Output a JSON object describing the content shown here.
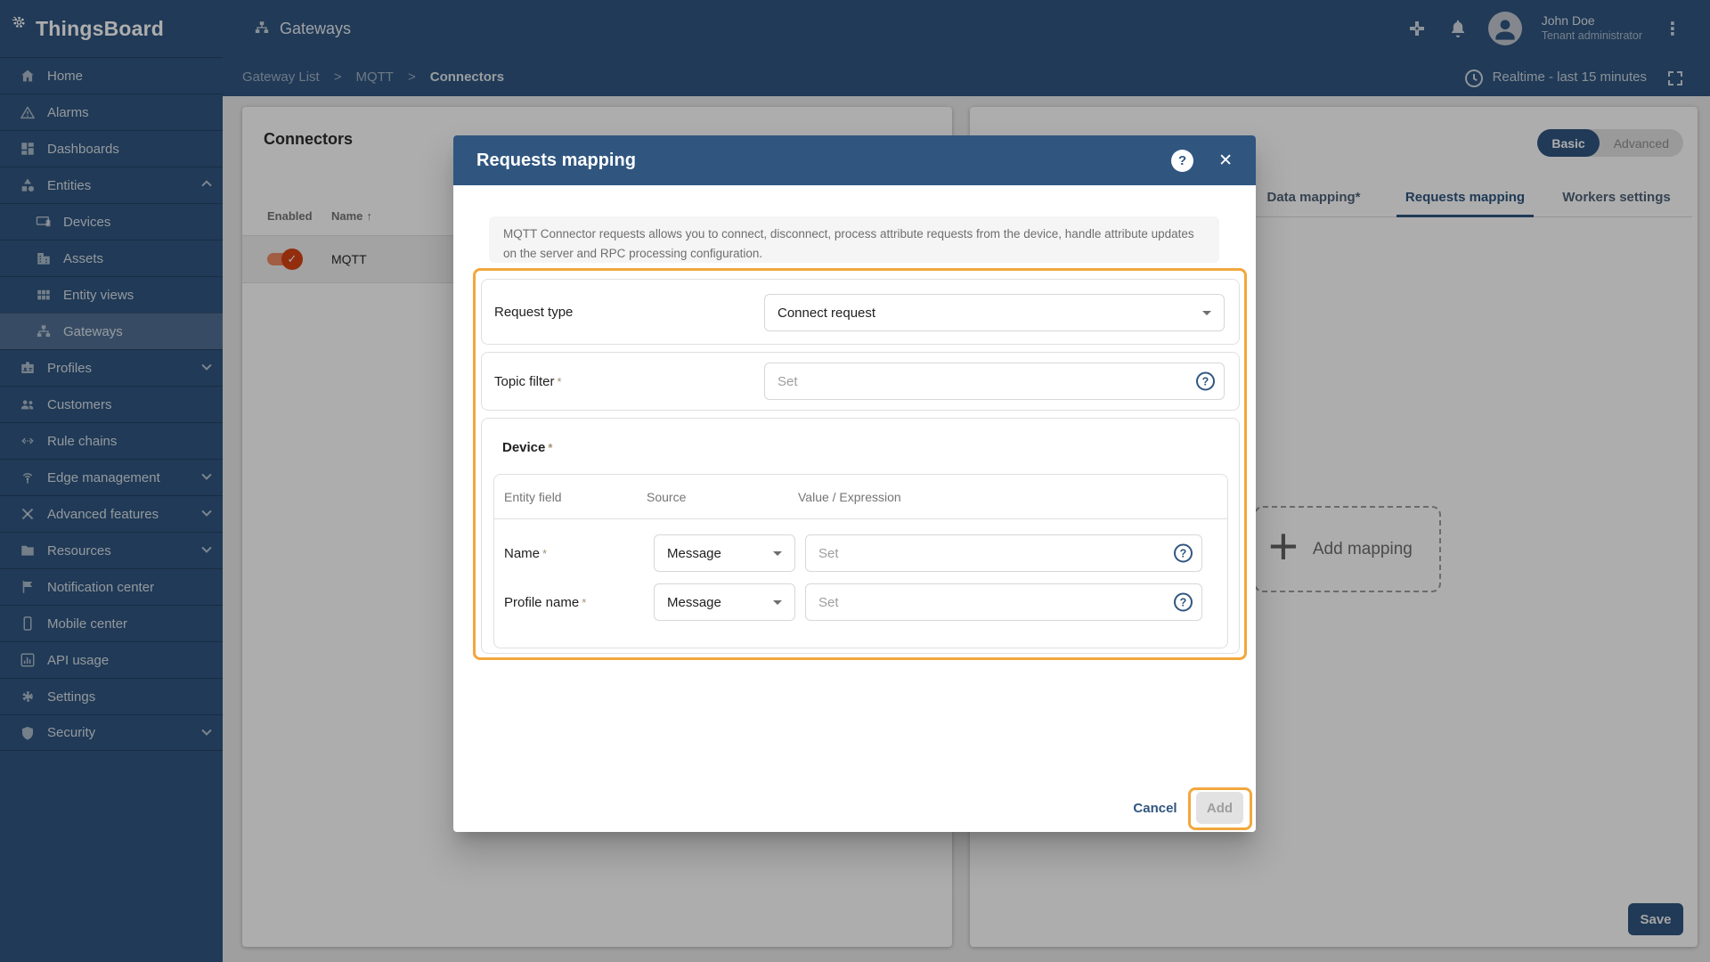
{
  "colors": {
    "primary": "#305680",
    "tutorial_highlight": "#f2a73d",
    "toggle_on": "#d84315"
  },
  "icons": {
    "sort_asc": "↑",
    "kebab": "⋮",
    "plus": "+",
    "close": "✕",
    "help": "?",
    "check": "✓"
  },
  "brand": {
    "name": "ThingsBoard"
  },
  "topbar": {
    "page_title": "Gateways",
    "user": {
      "name": "John Doe",
      "role": "Tenant administrator"
    }
  },
  "breadcrumb": {
    "separator": ">",
    "items": [
      "Gateway List",
      "MQTT",
      "Connectors"
    ]
  },
  "toolbar": {
    "realtime_label": "Realtime - last 15 minutes"
  },
  "sidebar": {
    "items": [
      {
        "label": "Home"
      },
      {
        "label": "Alarms"
      },
      {
        "label": "Dashboards"
      },
      {
        "label": "Entities"
      },
      {
        "label": "Devices"
      },
      {
        "label": "Assets"
      },
      {
        "label": "Entity views"
      },
      {
        "label": "Gateways"
      },
      {
        "label": "Profiles"
      },
      {
        "label": "Customers"
      },
      {
        "label": "Rule chains"
      },
      {
        "label": "Edge management"
      },
      {
        "label": "Advanced features"
      },
      {
        "label": "Resources"
      },
      {
        "label": "Notification center"
      },
      {
        "label": "Mobile center"
      },
      {
        "label": "API usage"
      },
      {
        "label": "Settings"
      },
      {
        "label": "Security"
      }
    ]
  },
  "connectors_panel": {
    "title": "Connectors",
    "columns": {
      "enabled": "Enabled",
      "name": "Name"
    },
    "rows": [
      {
        "name": "MQTT",
        "enabled": true
      }
    ]
  },
  "gateway_panel": {
    "mode": {
      "basic": "Basic",
      "advanced": "Advanced",
      "selected": "Basic"
    },
    "tabs": [
      {
        "label": "Data mapping*"
      },
      {
        "label": "Requests mapping"
      },
      {
        "label": "Workers settings"
      }
    ],
    "active_tab": "Requests mapping",
    "add_mapping_label": "Add mapping",
    "save_label": "Save"
  },
  "modal": {
    "title": "Requests mapping",
    "description": "MQTT Connector requests allows you to connect, disconnect, process attribute requests from the device, handle attribute updates on the server and RPC processing configuration.",
    "required_marker": "*",
    "request_type": {
      "label": "Request type",
      "value": "Connect request"
    },
    "topic_filter": {
      "label": "Topic filter",
      "placeholder": "Set"
    },
    "device": {
      "label": "Device",
      "columns": [
        "Entity field",
        "Source",
        "Value / Expression"
      ],
      "rows": [
        {
          "field": "Name",
          "source": "Message",
          "value_placeholder": "Set"
        },
        {
          "field": "Profile name",
          "source": "Message",
          "value_placeholder": "Set"
        }
      ]
    },
    "cancel_label": "Cancel",
    "add_label": "Add"
  }
}
